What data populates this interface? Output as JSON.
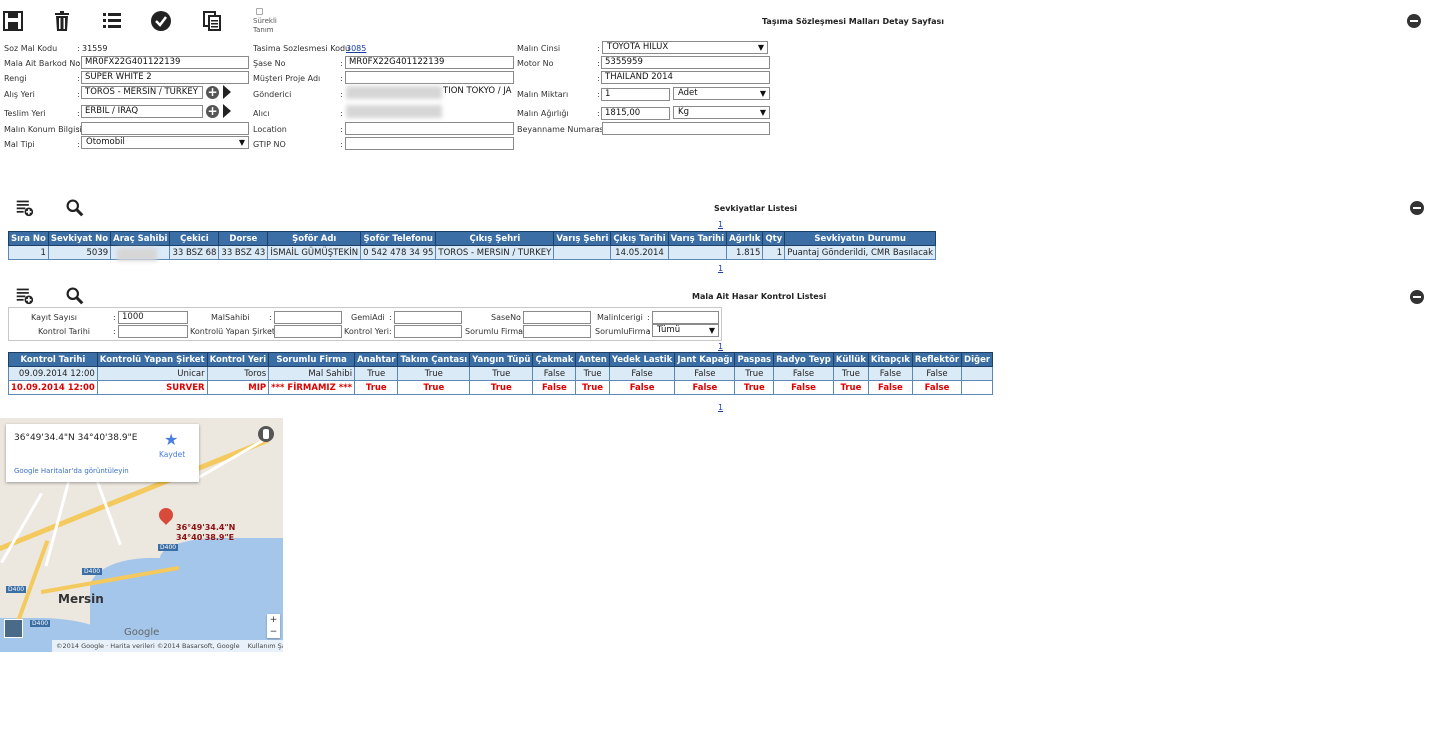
{
  "toolbar": {
    "continuous_label": "Sürekli Tanım",
    "page_title": "Taşıma Sözleşmesi Malları Detay Sayfası"
  },
  "form": {
    "left": [
      {
        "label": "Soz Mal Kodu",
        "value": "31559"
      },
      {
        "label": "Mala Ait Barkod No",
        "value": "MR0FX22G401122139"
      },
      {
        "label": "Rengi",
        "value": "SUPER WHITE 2"
      },
      {
        "label": "Alış Yeri",
        "value": "TOROS - MERSIN / TURKEY"
      },
      {
        "label": "Teslim Yeri",
        "value": "ERBIL / IRAQ"
      },
      {
        "label": "Malın Konum Bilgisi",
        "value": ""
      },
      {
        "label": "Mal Tipi",
        "value": "Otomobil"
      }
    ],
    "middle": [
      {
        "label": "Tasima Sozlesmesi Kodu",
        "value": "3085"
      },
      {
        "label": "Şase No",
        "value": "MR0FX22G401122139"
      },
      {
        "label": "Müşteri Proje Adı",
        "value": ""
      },
      {
        "label": "Gönderici",
        "value": "TION TOKYO / JA"
      },
      {
        "label": "Alıcı",
        "value": ""
      },
      {
        "label": "Location",
        "value": ""
      },
      {
        "label": "GTIP NO",
        "value": ""
      }
    ],
    "right": [
      {
        "label": "Malın Cinsi",
        "value": "TOYOTA HILUX"
      },
      {
        "label": "Motor No",
        "value": "5355959"
      },
      {
        "label": "",
        "value": "THAILAND 2014"
      },
      {
        "label": "Malın Miktarı",
        "value": "1",
        "unit": "Adet"
      },
      {
        "label": "Malın Ağırlığı",
        "value": "1815,00",
        "unit": "Kg"
      },
      {
        "label": "Beyanname Numarası",
        "value": ""
      }
    ]
  },
  "shipments": {
    "title": "Sevkiyatlar Listesi",
    "page": "1",
    "columns": [
      "Sıra No",
      "Sevkiyat No",
      "Araç Sahibi",
      "Çekici",
      "Dorse",
      "Şoför Adı",
      "Şoför Telefonu",
      "Çıkış Şehri",
      "Varış Şehri",
      "Çıkış Tarihi",
      "Varış Tarihi",
      "Ağırlık",
      "Qty",
      "Sevkiyatın Durumu"
    ],
    "rows": [
      [
        "1",
        "5039",
        "",
        "33 BSZ 68",
        "33 BSZ 43",
        "İSMAİL GÜMÜŞTEKİN",
        "0 542 478 34 95",
        "TOROS - MERSIN / TURKEY",
        "",
        "14.05.2014",
        "",
        "1.815",
        "1",
        "Puantaj Gönderildi, CMR Basılacak"
      ]
    ]
  },
  "damage": {
    "title": "Mala Ait Hasar Kontrol Listesi",
    "page": "1",
    "filters": {
      "record_count_label": "Kayıt Sayısı",
      "record_count": "1000",
      "control_date_label": "Kontrol Tarihi",
      "owner_label": "MalSahibi",
      "inspector_company_label": "Kontrolü Yapan Şirket",
      "ship_label": "GemiAdi",
      "control_place_label": "Kontrol Yeri",
      "chassis_label": "SaseNo",
      "responsible_label": "Sorumlu Firma",
      "content_label": "MalinIcerigi",
      "responsible_firm_label": "SorumluFirma",
      "responsible_firm_value": "Tümü"
    },
    "columns": [
      "Kontrol Tarihi",
      "Kontrolü Yapan Şirket",
      "Kontrol Yeri",
      "Sorumlu Firma",
      "Anahtar",
      "Takım Çantası",
      "Yangın Tüpü",
      "Çakmak",
      "Anten",
      "Yedek Lastik",
      "Jant Kapağı",
      "Paspas",
      "Radyo Teyp",
      "Küllük",
      "Kitapçık",
      "Reflektör",
      "Diğer"
    ],
    "rows": [
      [
        "09.09.2014 12:00",
        "Unicar",
        "Toros",
        "Mal Sahibi",
        "True",
        "True",
        "True",
        "False",
        "True",
        "False",
        "False",
        "True",
        "False",
        "True",
        "False",
        "False",
        ""
      ],
      [
        "10.09.2014 12:00",
        "SURVER",
        "MIP",
        "*** FİRMAMIZ ***",
        "True",
        "True",
        "True",
        "False",
        "True",
        "False",
        "False",
        "True",
        "False",
        "True",
        "False",
        "False",
        ""
      ]
    ]
  },
  "map": {
    "coords": "36°49'34.4\"N 34°40'38.9\"E",
    "save_label": "Kaydet",
    "view_link": "Google Haritalar'da görüntüleyin",
    "marker_label_1": "36°49'34.4\"N",
    "marker_label_2": "34°40'38.9\"E",
    "city": "Mersin",
    "google": "Google",
    "road_label": "D400",
    "road_label_2": "D400",
    "road_label_3": "D400",
    "road_label_4": "D400",
    "footer": "©2014 Google · Harita verileri ©2014 Basarsoft, Google",
    "terms": "Kullanım Şartları"
  }
}
